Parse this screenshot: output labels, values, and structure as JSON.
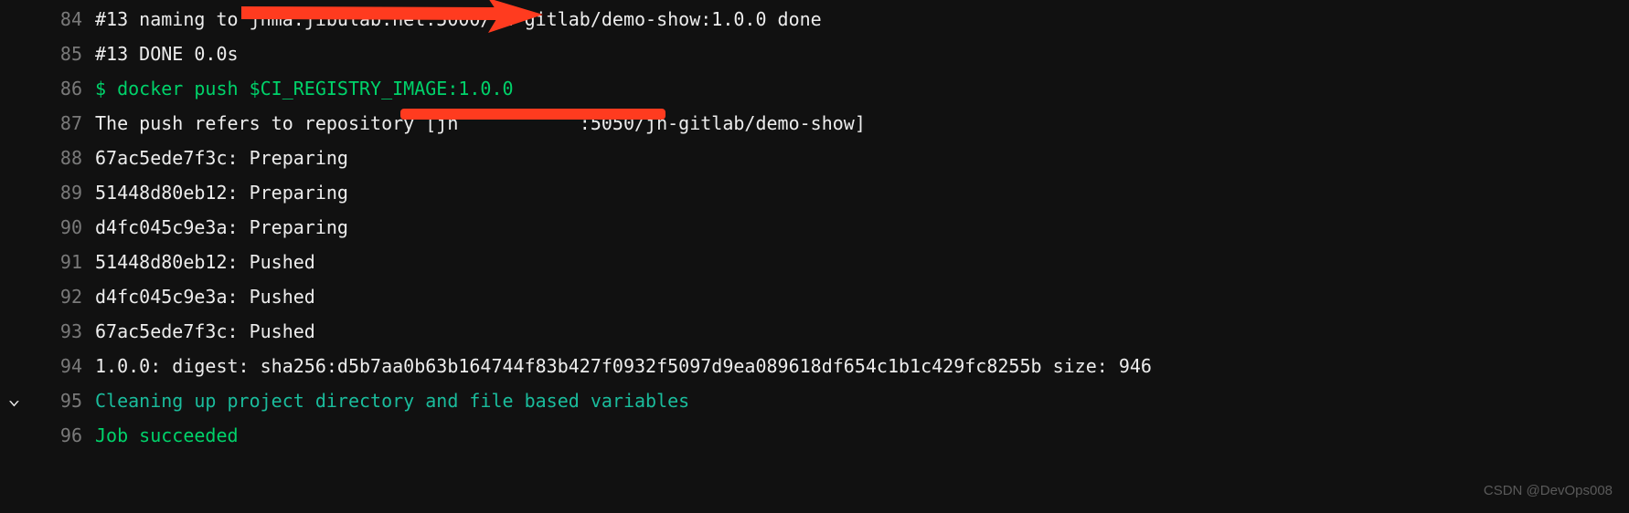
{
  "lines": [
    {
      "num": "84",
      "text": "#13 naming to jhma.jibulab.net:5000/jh-gitlab/demo-show:1.0.0 done",
      "cls": ""
    },
    {
      "num": "85",
      "text": "#13 DONE 0.0s",
      "cls": ""
    },
    {
      "num": "86",
      "text": "$ docker push $CI_REGISTRY_IMAGE:1.0.0",
      "cls": "green"
    },
    {
      "num": "87",
      "text": "The push refers to repository [jh           :5050/jh-gitlab/demo-show]",
      "cls": ""
    },
    {
      "num": "88",
      "text": "67ac5ede7f3c: Preparing",
      "cls": ""
    },
    {
      "num": "89",
      "text": "51448d80eb12: Preparing",
      "cls": ""
    },
    {
      "num": "90",
      "text": "d4fc045c9e3a: Preparing",
      "cls": ""
    },
    {
      "num": "91",
      "text": "51448d80eb12: Pushed",
      "cls": ""
    },
    {
      "num": "92",
      "text": "d4fc045c9e3a: Pushed",
      "cls": ""
    },
    {
      "num": "93",
      "text": "67ac5ede7f3c: Pushed",
      "cls": ""
    },
    {
      "num": "94",
      "text": "1.0.0: digest: sha256:d5b7aa0b63b164744f83b427f0932f5097d9ea089618df654c1b1c429fc8255b size: 946",
      "cls": ""
    },
    {
      "num": "95",
      "text": "Cleaning up project directory and file based variables",
      "cls": "cyan"
    },
    {
      "num": "96",
      "text": "Job succeeded",
      "cls": "green"
    }
  ],
  "watermark": "CSDN @DevOps008",
  "chevron": "⌄"
}
